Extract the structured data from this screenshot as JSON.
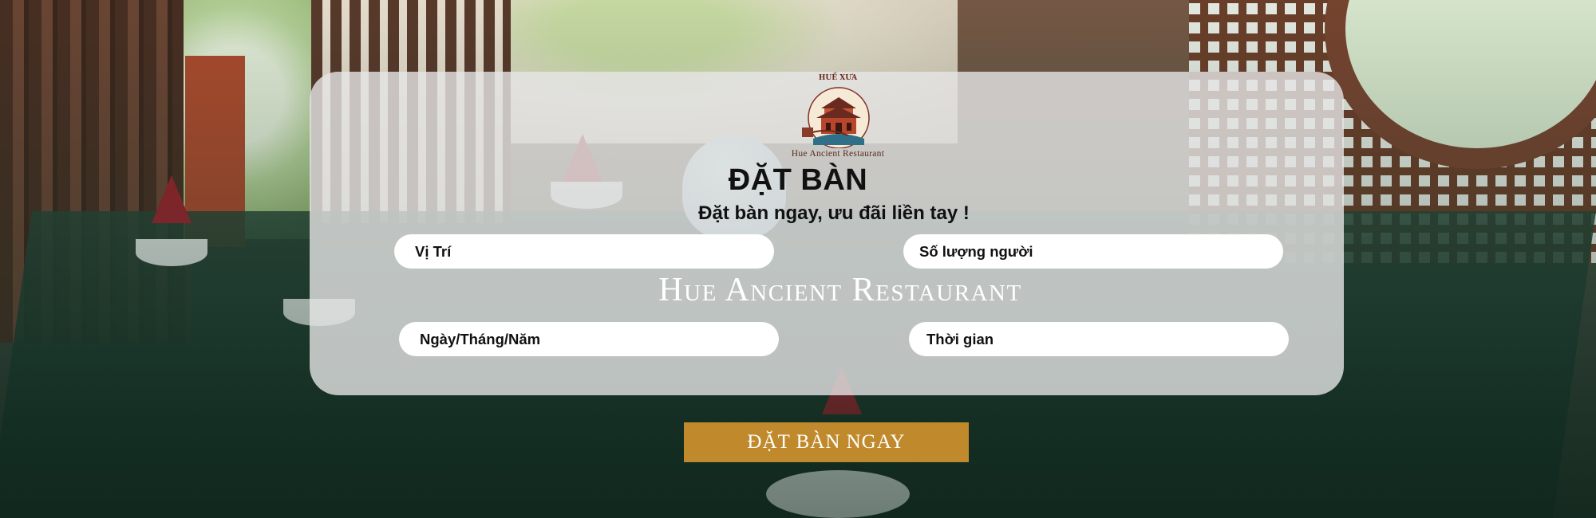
{
  "logo": {
    "top_text": "HUẾ XƯA",
    "bottom_text": "Hue Ancient Restaurant",
    "icon": "ancient-gate-icon"
  },
  "booking": {
    "title": "ĐẶT BÀN",
    "subtitle": "Đặt bàn ngay, ưu đãi liền tay !",
    "location_placeholder": "Vị Trí",
    "guests_placeholder": "Số lượng người",
    "date_placeholder": "Ngày/Tháng/Năm",
    "time_placeholder": "Thời gian",
    "watermark": "Hue Ancient Restaurant",
    "submit_label": "ĐẶT BÀN NGAY"
  },
  "colors": {
    "card": "#e6e6e6",
    "button": "#c08a2c",
    "text": "#111111"
  }
}
